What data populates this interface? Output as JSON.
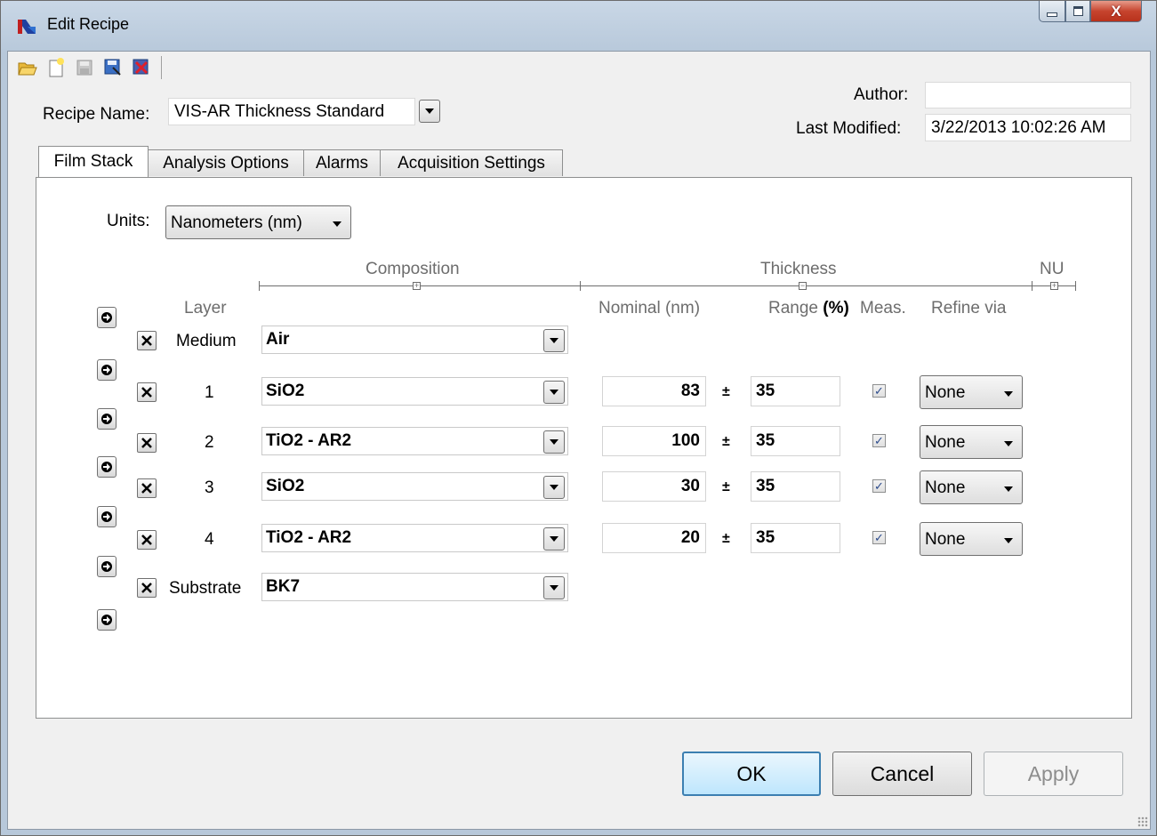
{
  "window": {
    "title": "Edit Recipe",
    "close_glyph": "X"
  },
  "recipe": {
    "name_label": "Recipe Name:",
    "name_value": "VIS-AR Thickness Standard"
  },
  "meta": {
    "author_label": "Author:",
    "author_value": "",
    "modified_label": "Last Modified:",
    "modified_value": "3/22/2013 10:02:26 AM"
  },
  "tabs": [
    {
      "label": "Film Stack",
      "active": true
    },
    {
      "label": "Analysis Options"
    },
    {
      "label": "Alarms"
    },
    {
      "label": "Acquisition Settings"
    }
  ],
  "units": {
    "label": "Units:",
    "value": "Nanometers (nm)"
  },
  "headers": {
    "composition": "Composition",
    "thickness": "Thickness",
    "nu": "NU",
    "layer": "Layer",
    "nominal": "Nominal (nm)",
    "range_prefix": "Range ",
    "range_unit": "(%)",
    "meas": "Meas.",
    "refine": "Refine via",
    "plus_minus": "±"
  },
  "layers": [
    {
      "name": "Medium",
      "material": "Air"
    },
    {
      "name": "1",
      "material": "SiO2",
      "nominal": "83",
      "range": "35",
      "meas": true,
      "refine": "None"
    },
    {
      "name": "2",
      "material": "TiO2 - AR2",
      "nominal": "100",
      "range": "35",
      "meas": true,
      "refine": "None"
    },
    {
      "name": "3",
      "material": "SiO2",
      "nominal": "30",
      "range": "35",
      "meas": true,
      "refine": "None"
    },
    {
      "name": "4",
      "material": "TiO2 - AR2",
      "nominal": "20",
      "range": "35",
      "meas": true,
      "refine": "None"
    },
    {
      "name": "Substrate",
      "material": "BK7"
    }
  ],
  "buttons": {
    "ok": "OK",
    "cancel": "Cancel",
    "apply": "Apply"
  }
}
